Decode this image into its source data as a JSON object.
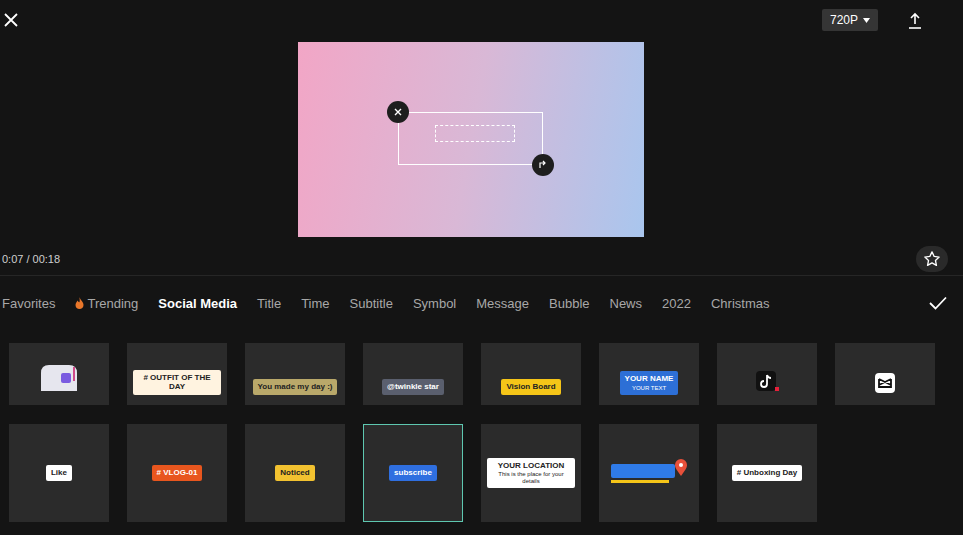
{
  "toolbar": {
    "resolution": "720P"
  },
  "player": {
    "time": "0:07 / 00:18"
  },
  "tabs": [
    {
      "label": "Favorites",
      "selected": false
    },
    {
      "label": "Trending",
      "selected": false
    },
    {
      "label": "Social Media",
      "selected": true
    },
    {
      "label": "Title",
      "selected": false
    },
    {
      "label": "Time",
      "selected": false
    },
    {
      "label": "Subtitle",
      "selected": false
    },
    {
      "label": "Symbol",
      "selected": false
    },
    {
      "label": "Message",
      "selected": false
    },
    {
      "label": "Bubble",
      "selected": false
    },
    {
      "label": "News",
      "selected": false
    },
    {
      "label": "2022",
      "selected": false
    },
    {
      "label": "Christmas",
      "selected": false
    }
  ],
  "sticker_rows": [
    [
      {
        "kind": "mailbox",
        "label": "",
        "sub": "",
        "color": "#e6e6ee",
        "selected": false
      },
      {
        "kind": "chip",
        "label": "# OUTFIT OF THE DAY",
        "sub": "",
        "color": "#fff3e0",
        "selected": false
      },
      {
        "kind": "chip",
        "label": "You made my day :)",
        "sub": "",
        "color": "#b9a86a",
        "selected": false
      },
      {
        "kind": "chip",
        "label": "@twinkle star",
        "sub": "",
        "color": "#5a5f6e",
        "selected": false
      },
      {
        "kind": "chip",
        "label": "Vision Board",
        "sub": "",
        "color": "#f5c518",
        "selected": false
      },
      {
        "kind": "chip",
        "label": "YOUR NAME",
        "sub": "YOUR TEXT",
        "color": "#2d6fd6",
        "selected": false
      },
      {
        "kind": "tiktok",
        "label": "",
        "sub": "",
        "color": "#111111",
        "selected": false
      },
      {
        "kind": "capcut",
        "label": "",
        "sub": "",
        "color": "#ffffff",
        "selected": false
      }
    ],
    [
      {
        "kind": "chip",
        "label": "Like",
        "sub": "",
        "color": "#ffffff",
        "selected": false
      },
      {
        "kind": "chip",
        "label": "# VLOG-01",
        "sub": "",
        "color": "#e8561e",
        "selected": false
      },
      {
        "kind": "chip",
        "label": "Noticed",
        "sub": "",
        "color": "#f2c230",
        "selected": false
      },
      {
        "kind": "chip",
        "label": "subscribe",
        "sub": "",
        "color": "#2f6fe0",
        "selected": true
      },
      {
        "kind": "chip",
        "label": "YOUR LOCATION",
        "sub": "This is the place for your details",
        "color": "#ffffff",
        "selected": false
      },
      {
        "kind": "locationbar",
        "label": "",
        "sub": "",
        "color": "#2f7be8",
        "selected": false
      },
      {
        "kind": "chip",
        "label": "# Unboxing Day",
        "sub": "",
        "color": "#ffffff",
        "selected": false
      }
    ]
  ]
}
